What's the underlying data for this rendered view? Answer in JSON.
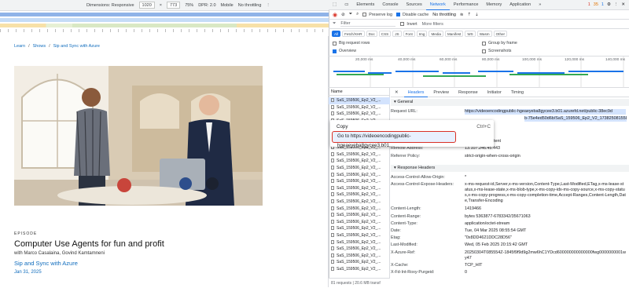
{
  "device_toolbar": {
    "dimensions": "Dimensions: Responsive",
    "width": "1020",
    "height": "773",
    "zoom": "75%",
    "dpr": "DPR: 2.0",
    "device": "Mobile",
    "throttle": "No throttling"
  },
  "page": {
    "breadcrumb": [
      "Learn",
      "Shows",
      "Sip and Sync with Azure"
    ],
    "episode_label": "EPISODE",
    "title": "Computer Use Agents for fun and profit",
    "authors": "with Marco Casalaina, Govind Kamtamneni",
    "series": "Sip and Sync with Azure",
    "date": "Jan 31, 2025"
  },
  "devtools": {
    "tabs": [
      "Elements",
      "Console",
      "Sources",
      "Network",
      "Performance",
      "Memory",
      "Application"
    ],
    "active_tab": "Network",
    "errors": "1",
    "warnings": "35",
    "info": "1",
    "toolbar": {
      "preserve_log": "Preserve log",
      "disable_cache": "Disable cache",
      "throttle": "No throttling"
    },
    "filter": {
      "placeholder": "Filter",
      "invert": "Invert",
      "more_filters": "More filters"
    },
    "types": [
      "All",
      "Fetch/XHR",
      "Doc",
      "CSS",
      "JS",
      "Font",
      "Img",
      "Media",
      "Manifest",
      "WS",
      "Wasm",
      "Other"
    ],
    "options": {
      "big_rows": "Big request rows",
      "overview": "Overview",
      "group_by_frame": "Group by frame",
      "screenshots": "Screenshots"
    },
    "timeline_ticks": [
      "20,000 ms",
      "40,000 ms",
      "60,000 ms",
      "80,000 ms",
      "100,000 ms",
      "120,000 ms",
      "140,000 ms"
    ],
    "name_header": "Name",
    "rows": [
      "SaS_159506_Ep2_V2_...",
      "SaS_159506_Ep2_V2_...",
      "SaS_159506_Ep2_V2_...",
      "SaS_159506_Ep2_V2_...",
      "SaS_159506_Ep2_V2_...",
      "SaS_159506_Ep2_V2_...",
      "SaS_159506_Ep2_V2_...",
      "SaS_159506_Ep2_V2_...",
      "SaS_159506_Ep2_V2_...",
      "SaS_159506_Ep2_V2_...",
      "SaS_159506_Ep2_V2_...",
      "SaS_159506_Ep2_V2_...",
      "SaS_159506_Ep2_V2_...",
      "SaS_159506_Ep2_V2_...",
      "SaS_159506_Ep2_V2_...",
      "SaS_159506_Ep2_V2_...",
      "SaS_159506_Ep2_V2_...",
      "SaS_159506_Ep2_V2_...",
      "SaS_159506_Ep2_V2_...",
      "SaS_159506_Ep2_V2_...",
      "SaS_159506_Ep2_V2_...",
      "SaS_159506_Ep2_V2_...",
      "SaS_159506_Ep2_V2_...",
      "SaS_159506_Ep2_V2_...",
      "SaS_159506_Ep2_V2_...",
      "SaS_159506_Ep2_V2_..."
    ],
    "status": "81 requests  |  20.6 MB transf",
    "detail_tabs": [
      "Headers",
      "Preview",
      "Response",
      "Initiator",
      "Timing"
    ],
    "general_label": "General",
    "request_url_key": "Request URL:",
    "request_url": "https://videoencodingpublic-hgeaeyeba8gycee3.b01.azurefd.net/public-38ec9d",
    "request_url_2": "b-75e4ed50d6b/SaS_159506_Ep2_V2_1738250815589_1280x7",
    "request_line_3": "ontent",
    "remote_key": "Remote Address:",
    "remote_val": "13.107.246.45:443",
    "referrer_key": "Referrer Policy:",
    "referrer_val": "strict-origin-when-cross-origin",
    "response_headers_label": "Response Headers",
    "headers": [
      {
        "k": "Access-Control-Allow-Origin:",
        "v": "*"
      },
      {
        "k": "Access-Control-Expose-Headers:",
        "v": "x-ms-request-id,Server,x-ms-version,Content-Type,Last-Modified,ETag,x-ms-lease-status,x-ms-lease-state,x-ms-blob-type,x-ms-copy-idx-ms-copy-source,x-ms-copy-status,x-ms-copy-progress,x-ms-copy-completion-time,Accept-Ranges,Content-Length,Date,Transfer-Encoding"
      },
      {
        "k": "Content-Length:",
        "v": "1419466"
      },
      {
        "k": "Content-Range:",
        "v": "bytes 5363877-6783342/35671063"
      },
      {
        "k": "Content-Type:",
        "v": "application/octet-stream"
      },
      {
        "k": "Date:",
        "v": "Tue, 04 Mar 2025 08:55:54 GMT"
      },
      {
        "k": "Etag:",
        "v": "\"0x8DD4621DDC28D56\""
      },
      {
        "k": "Last-Modified:",
        "v": "Wed, 05 Feb 2025 20:15:42 GMT"
      },
      {
        "k": "X-Azure-Ref:",
        "v": "20250304T085554Z-1845f9f9d9g2mw6hC1YDcd600000000000000fwg0000000001wy47"
      },
      {
        "k": "X-Cache:",
        "v": "TCP_HIT"
      },
      {
        "k": "X-Fd-Int-Roxy-Purgeid:",
        "v": "0"
      }
    ],
    "context_menu": {
      "copy": "Copy",
      "shortcut": "Ctrl+C",
      "goto": "Go to https://videoencodingpublic-hgeaeyeba8gycee3.b01...."
    }
  }
}
